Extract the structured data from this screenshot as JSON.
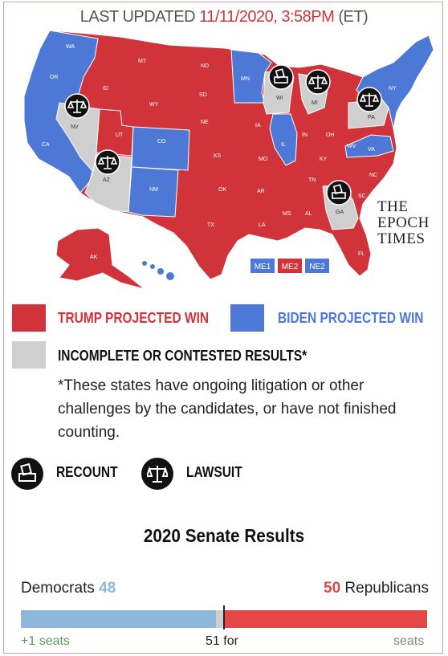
{
  "header": {
    "prefix": "LAST UPDATED",
    "date": "11/11/2020, 3:58PM",
    "suffix": "(ET)"
  },
  "colors": {
    "trump": "#d0343a",
    "biden": "#4e78d6",
    "contested": "#cfcfcf",
    "dem_bar": "#8db8dc",
    "rep_bar": "#e24848"
  },
  "map": {
    "state_labels": [
      {
        "abbr": "WA",
        "status": "biden"
      },
      {
        "abbr": "OR",
        "status": "biden"
      },
      {
        "abbr": "CA",
        "status": "biden"
      },
      {
        "abbr": "NV",
        "status": "contested"
      },
      {
        "abbr": "ID",
        "status": "trump"
      },
      {
        "abbr": "MT",
        "status": "trump"
      },
      {
        "abbr": "WY",
        "status": "trump"
      },
      {
        "abbr": "UT",
        "status": "trump"
      },
      {
        "abbr": "AZ",
        "status": "contested"
      },
      {
        "abbr": "CO",
        "status": "biden"
      },
      {
        "abbr": "NM",
        "status": "biden"
      },
      {
        "abbr": "ND",
        "status": "trump"
      },
      {
        "abbr": "SD",
        "status": "trump"
      },
      {
        "abbr": "NE",
        "status": "trump"
      },
      {
        "abbr": "KS",
        "status": "trump"
      },
      {
        "abbr": "OK",
        "status": "trump"
      },
      {
        "abbr": "TX",
        "status": "trump"
      },
      {
        "abbr": "MN",
        "status": "biden"
      },
      {
        "abbr": "IA",
        "status": "trump"
      },
      {
        "abbr": "MO",
        "status": "trump"
      },
      {
        "abbr": "AR",
        "status": "trump"
      },
      {
        "abbr": "LA",
        "status": "trump"
      },
      {
        "abbr": "WI",
        "status": "contested"
      },
      {
        "abbr": "IL",
        "status": "biden"
      },
      {
        "abbr": "MI",
        "status": "contested"
      },
      {
        "abbr": "IN",
        "status": "trump"
      },
      {
        "abbr": "OH",
        "status": "trump"
      },
      {
        "abbr": "KY",
        "status": "trump"
      },
      {
        "abbr": "TN",
        "status": "trump"
      },
      {
        "abbr": "MS",
        "status": "trump"
      },
      {
        "abbr": "AL",
        "status": "trump"
      },
      {
        "abbr": "GA",
        "status": "contested"
      },
      {
        "abbr": "FL",
        "status": "trump"
      },
      {
        "abbr": "SC",
        "status": "trump"
      },
      {
        "abbr": "NC",
        "status": "trump"
      },
      {
        "abbr": "VA",
        "status": "biden"
      },
      {
        "abbr": "WV",
        "status": "trump"
      },
      {
        "abbr": "PA",
        "status": "contested"
      },
      {
        "abbr": "NY",
        "status": "biden"
      },
      {
        "abbr": "AK",
        "status": "trump"
      },
      {
        "abbr": "HI",
        "status": "biden"
      }
    ],
    "district_boxes": [
      {
        "label": "ME1",
        "status": "biden"
      },
      {
        "label": "ME2",
        "status": "trump"
      },
      {
        "label": "NE2",
        "status": "biden"
      }
    ],
    "markers": [
      {
        "state": "NV",
        "type": "lawsuit"
      },
      {
        "state": "AZ",
        "type": "lawsuit"
      },
      {
        "state": "WI",
        "type": "recount"
      },
      {
        "state": "MI",
        "type": "lawsuit"
      },
      {
        "state": "PA",
        "type": "lawsuit"
      },
      {
        "state": "GA",
        "type": "recount"
      }
    ],
    "watermark_lines": [
      "THE",
      "EPOCH",
      "TIMES"
    ]
  },
  "legend": {
    "trump": "TRUMP PROJECTED WIN",
    "biden": "BIDEN PROJECTED WIN",
    "contested": "INCOMPLETE OR CONTESTED RESULTS*",
    "note": "*These states have ongoing litigation or other challenges by the candidates, or have not finished counting.",
    "recount": "RECOUNT",
    "lawsuit": "LAWSUIT"
  },
  "senate": {
    "title": "2020 Senate Results",
    "dem_label": "Democrats",
    "dem_seats": "48",
    "rep_seats": "50",
    "rep_label": "Republicans",
    "threshold": "51 for",
    "dem_change": "+1 seats",
    "rep_change": "seats",
    "dem_value": 48,
    "rep_value": 50,
    "total": 100
  }
}
